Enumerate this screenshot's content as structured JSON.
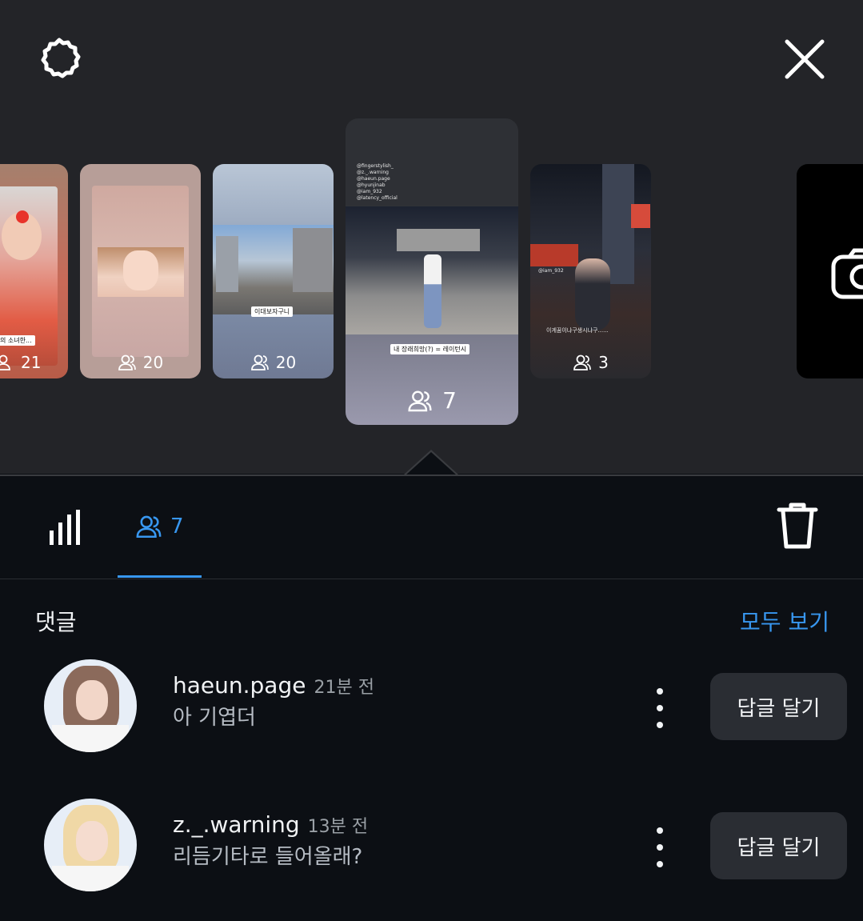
{
  "header": {
    "settings_icon": "gear-icon",
    "close_icon": "close-icon"
  },
  "story_thumbnails": [
    {
      "viewer_count": "21",
      "caption": "의 소녀한..."
    },
    {
      "viewer_count": "20"
    },
    {
      "viewer_count": "20",
      "caption": "이대보자구니"
    },
    {
      "viewer_count": "7",
      "caption": "내 장래희망(?) = 레이턴시",
      "tags": [
        "@fingerstylish_",
        "@z._.warning",
        "@haeun.page",
        "@hyunjinab",
        "@iam_932",
        "@latency_official"
      ]
    },
    {
      "viewer_count": "3",
      "caption": "이게꿈이냐구생시냐구......",
      "tag": "@iam_932"
    }
  ],
  "tabs": {
    "stats_icon": "bar-chart-icon",
    "viewers_count": "7",
    "delete_icon": "trash-icon"
  },
  "comments_section": {
    "title": "댓글",
    "see_all": "모두 보기",
    "items": [
      {
        "username": "haeun.page",
        "time": "21분 전",
        "text": "아 기엽더",
        "reply_label": "답글 달기"
      },
      {
        "username": "z._.warning",
        "time": "13분 전",
        "text": "리듬기타로 들어올래?",
        "reply_label": "답글 달기"
      }
    ]
  },
  "colors": {
    "accent": "#3897f0",
    "background": "#0c0f14",
    "top_panel": "#232428"
  }
}
